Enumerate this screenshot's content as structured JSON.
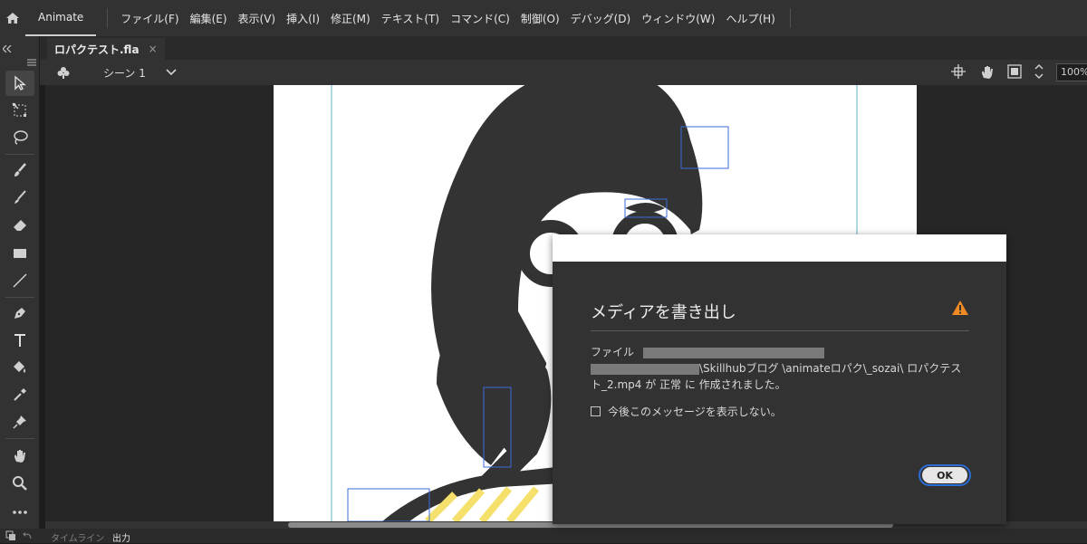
{
  "app": {
    "name": "Animate"
  },
  "menu": [
    "ファイル(F)",
    "編集(E)",
    "表示(V)",
    "挿入(I)",
    "修正(M)",
    "テキスト(T)",
    "コマンド(C)",
    "制御(O)",
    "デバッグ(D)",
    "ウィンドウ(W)",
    "ヘルプ(H)"
  ],
  "document_tab": {
    "title": "ロパクテスト.fla",
    "close": "×"
  },
  "scene": {
    "name": "シーン 1",
    "zoom": "100%"
  },
  "bottom_tabs": [
    "タイムライン",
    "出力"
  ],
  "dialog": {
    "title": "メディアを書き出し",
    "message_prefix": "ファイル",
    "message_path": "\\Skillhubブログ \\animateロパク\\_sozai\\ ロパクテスト_2.mp4 が 正常 に 作成されました。",
    "checkbox_label": "今後このメッセージを表示しない。",
    "checkbox_checked": false,
    "ok_label": "OK"
  },
  "colors": {
    "accent": "#2b6cd4",
    "warning": "#f08a24",
    "stripe": "#f4e06a",
    "figure": "#333333"
  }
}
